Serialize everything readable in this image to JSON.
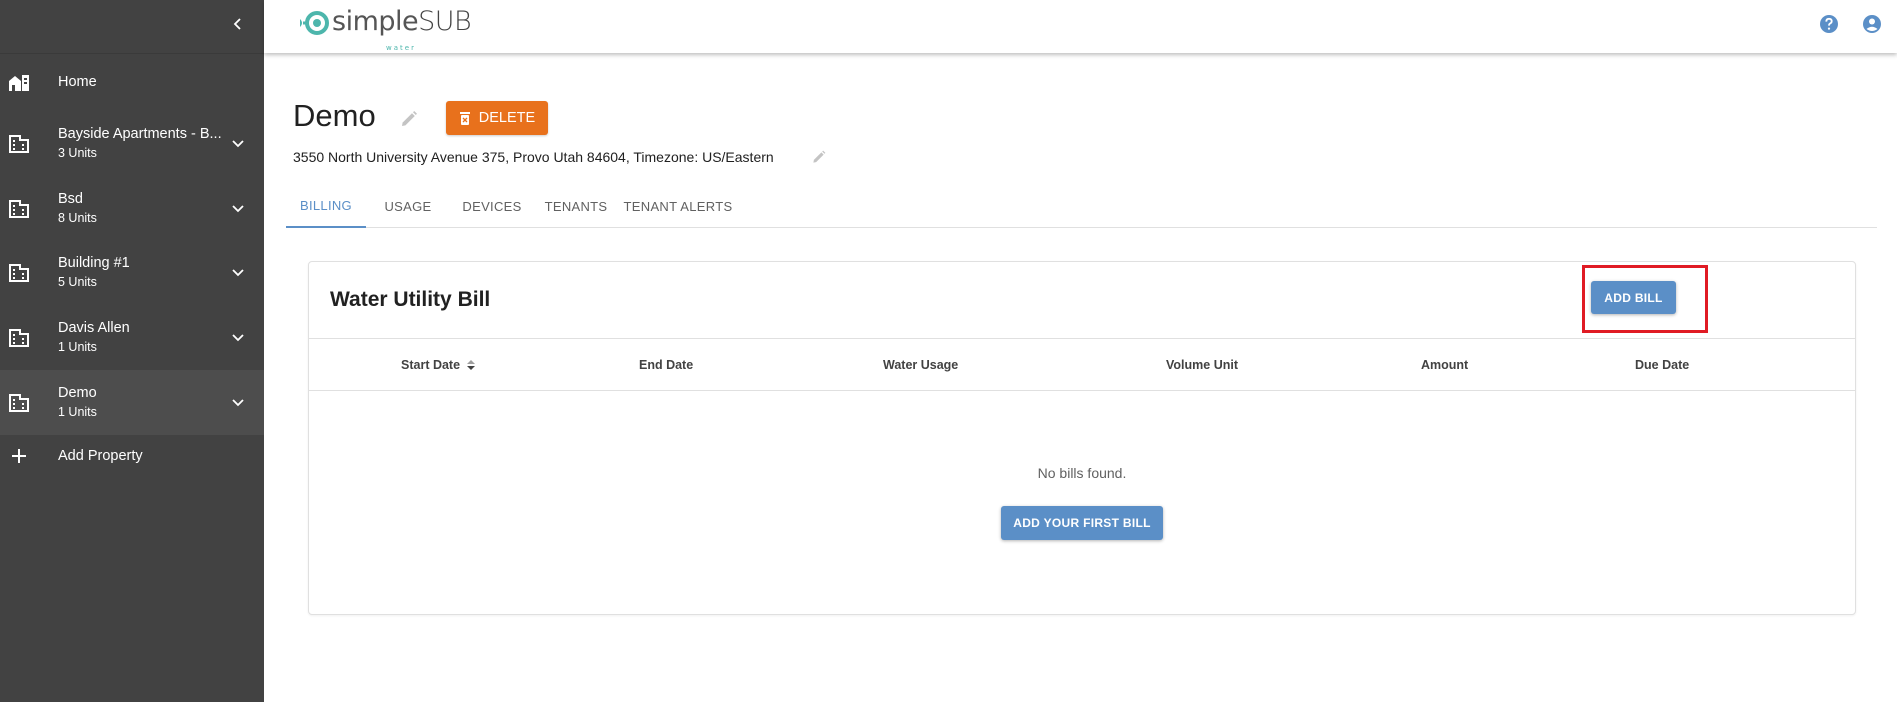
{
  "app": {
    "logo_text_main": "simple",
    "logo_text_sub": "SUB",
    "logo_text_small": "water"
  },
  "sidebar": {
    "collapse_icon": "chevron-left-icon",
    "home": {
      "label": "Home",
      "icon": "home-building-icon"
    },
    "properties": [
      {
        "name": "Bayside Apartments - B...",
        "units": "3 Units",
        "icon": "building-icon"
      },
      {
        "name": "Bsd",
        "units": "8 Units",
        "icon": "building-icon"
      },
      {
        "name": "Building #1",
        "units": "5 Units",
        "icon": "building-icon"
      },
      {
        "name": "Davis Allen",
        "units": "1 Units",
        "icon": "building-icon"
      },
      {
        "name": "Demo",
        "units": "1 Units",
        "icon": "building-icon",
        "active": true
      }
    ],
    "add_property": {
      "label": "Add Property",
      "icon": "plus-icon"
    }
  },
  "topbar": {
    "help_icon": "help-circle-icon",
    "account_icon": "account-circle-icon"
  },
  "property": {
    "title": "Demo",
    "delete_label": "DELETE",
    "address": "3550 North University Avenue 375, Provo Utah 84604, Timezone: US/Eastern"
  },
  "tabs": [
    {
      "label": "BILLING",
      "active": true
    },
    {
      "label": "USAGE"
    },
    {
      "label": "DEVICES"
    },
    {
      "label": "TENANTS"
    },
    {
      "label": "TENANT ALERTS"
    }
  ],
  "bill_card": {
    "title": "Water Utility Bill",
    "add_label": "ADD BILL",
    "columns": [
      "Start Date",
      "End Date",
      "Water Usage",
      "Volume Unit",
      "Amount",
      "Due Date"
    ],
    "empty_message": "No bills found.",
    "add_first_label": "ADD YOUR FIRST BILL"
  },
  "colors": {
    "sidebar_bg": "#424242",
    "accent_blue": "#5b8fc7",
    "delete_orange": "#e8711c",
    "highlight_red": "#e01b24"
  }
}
